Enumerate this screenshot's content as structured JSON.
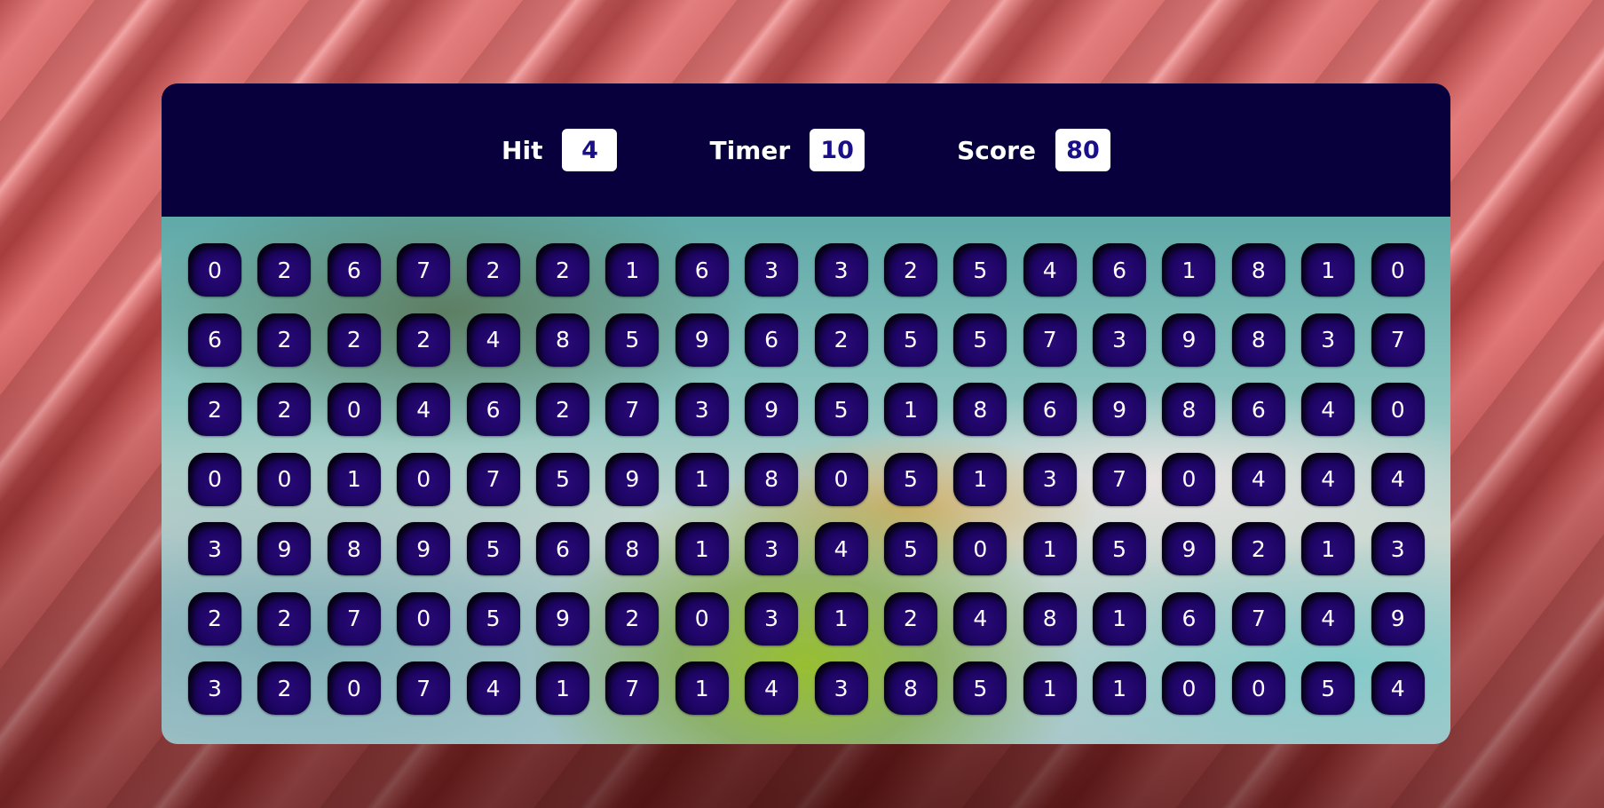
{
  "stats": {
    "hit_label": "Hit",
    "hit_value": "4",
    "timer_label": "Timer",
    "timer_value": "10",
    "score_label": "Score",
    "score_value": "80"
  },
  "grid": {
    "columns": 18,
    "rows": [
      [
        "0",
        "2",
        "6",
        "7",
        "2",
        "2",
        "1",
        "6",
        "3",
        "3",
        "2",
        "5",
        "4",
        "6",
        "1",
        "8",
        "1",
        "0"
      ],
      [
        "6",
        "2",
        "2",
        "2",
        "4",
        "8",
        "5",
        "9",
        "6",
        "2",
        "5",
        "5",
        "7",
        "3",
        "9",
        "8",
        "3",
        "7"
      ],
      [
        "2",
        "2",
        "0",
        "4",
        "6",
        "2",
        "7",
        "3",
        "9",
        "5",
        "1",
        "8",
        "6",
        "9",
        "8",
        "6",
        "4",
        "0"
      ],
      [
        "0",
        "0",
        "1",
        "0",
        "7",
        "5",
        "9",
        "1",
        "8",
        "0",
        "5",
        "1",
        "3",
        "7",
        "0",
        "4",
        "4",
        "4"
      ],
      [
        "3",
        "9",
        "8",
        "9",
        "5",
        "6",
        "8",
        "1",
        "3",
        "4",
        "5",
        "0",
        "1",
        "5",
        "9",
        "2",
        "1",
        "3"
      ],
      [
        "2",
        "2",
        "7",
        "0",
        "5",
        "9",
        "2",
        "0",
        "3",
        "1",
        "2",
        "4",
        "8",
        "1",
        "6",
        "7",
        "4",
        "9"
      ],
      [
        "3",
        "2",
        "0",
        "7",
        "4",
        "1",
        "7",
        "1",
        "4",
        "3",
        "8",
        "5",
        "1",
        "1",
        "0",
        "0",
        "5",
        "4"
      ]
    ]
  },
  "colors": {
    "header_bg": "#08003c",
    "bubble": "#1e0566",
    "value_text": "#1a0f8a"
  }
}
